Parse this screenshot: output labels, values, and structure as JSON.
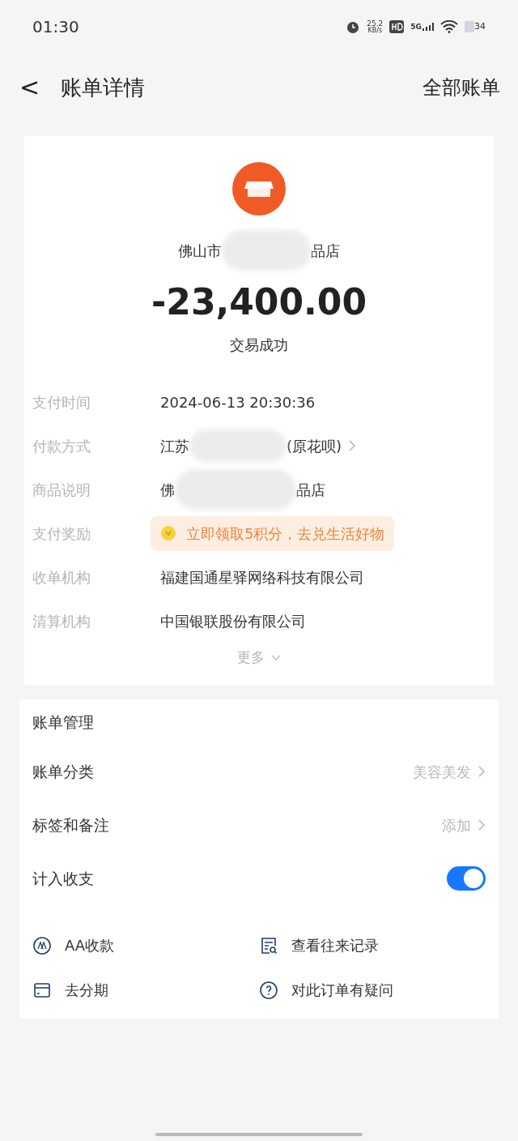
{
  "status_bar": {
    "time": "01:30",
    "net_speed": "25.2",
    "net_unit": "KB/s",
    "network": "5G",
    "battery": "34"
  },
  "header": {
    "back": "<",
    "title": "账单详情",
    "action": "全部账单"
  },
  "merchant": {
    "name_start": "佛山市",
    "name_end": "品店",
    "amount": "-23,400.00",
    "status": "交易成功"
  },
  "details": [
    {
      "kind": "text",
      "label": "支付时间",
      "value": "2024-06-13 20:30:36"
    },
    {
      "kind": "redacted_link",
      "label": "付款方式",
      "value_start": "江苏",
      "value_end": "(原花呗)"
    },
    {
      "kind": "redacted",
      "label": "商品说明",
      "value_start": "佛",
      "value_end": "品店"
    },
    {
      "kind": "reward",
      "label": "支付奖励",
      "value": "立即领取5积分，去兑生活好物"
    },
    {
      "kind": "text",
      "label": "收单机构",
      "value": "福建国通星驿网络科技有限公司"
    },
    {
      "kind": "text",
      "label": "清算机构",
      "value": "中国银联股份有限公司"
    }
  ],
  "more": "更多",
  "management": {
    "title": "账单管理",
    "rows": [
      {
        "kind": "link",
        "label": "账单分类",
        "value": "美容美发"
      },
      {
        "kind": "link",
        "label": "标签和备注",
        "value": "添加"
      },
      {
        "kind": "toggle",
        "label": "计入收支",
        "on": true
      }
    ]
  },
  "actions": [
    {
      "kind": "aa",
      "label": "AA收款"
    },
    {
      "kind": "records",
      "label": "查看往来记录"
    },
    {
      "kind": "installment",
      "label": "去分期"
    },
    {
      "kind": "question",
      "label": "对此订单有疑问"
    }
  ]
}
